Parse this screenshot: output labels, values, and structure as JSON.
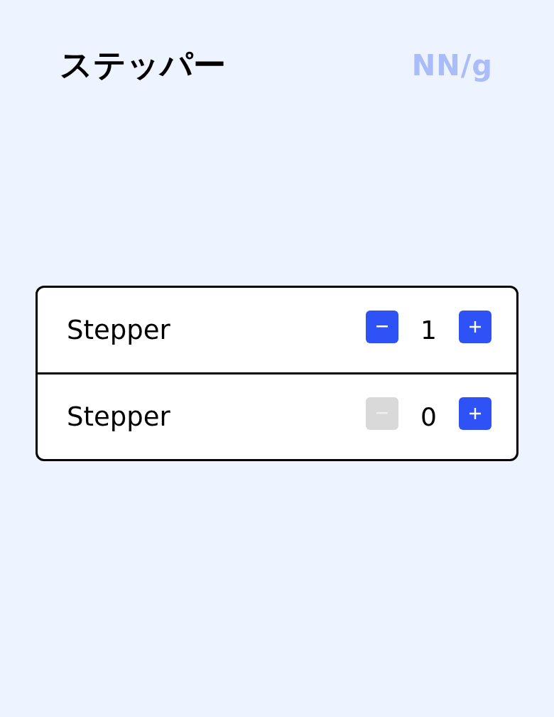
{
  "title": "ステッパー",
  "logo": "NN/g",
  "steppers": [
    {
      "label": "Stepper",
      "value": "1",
      "decrement_disabled": false,
      "increment_disabled": false
    },
    {
      "label": "Stepper",
      "value": "0",
      "decrement_disabled": true,
      "increment_disabled": false
    }
  ]
}
